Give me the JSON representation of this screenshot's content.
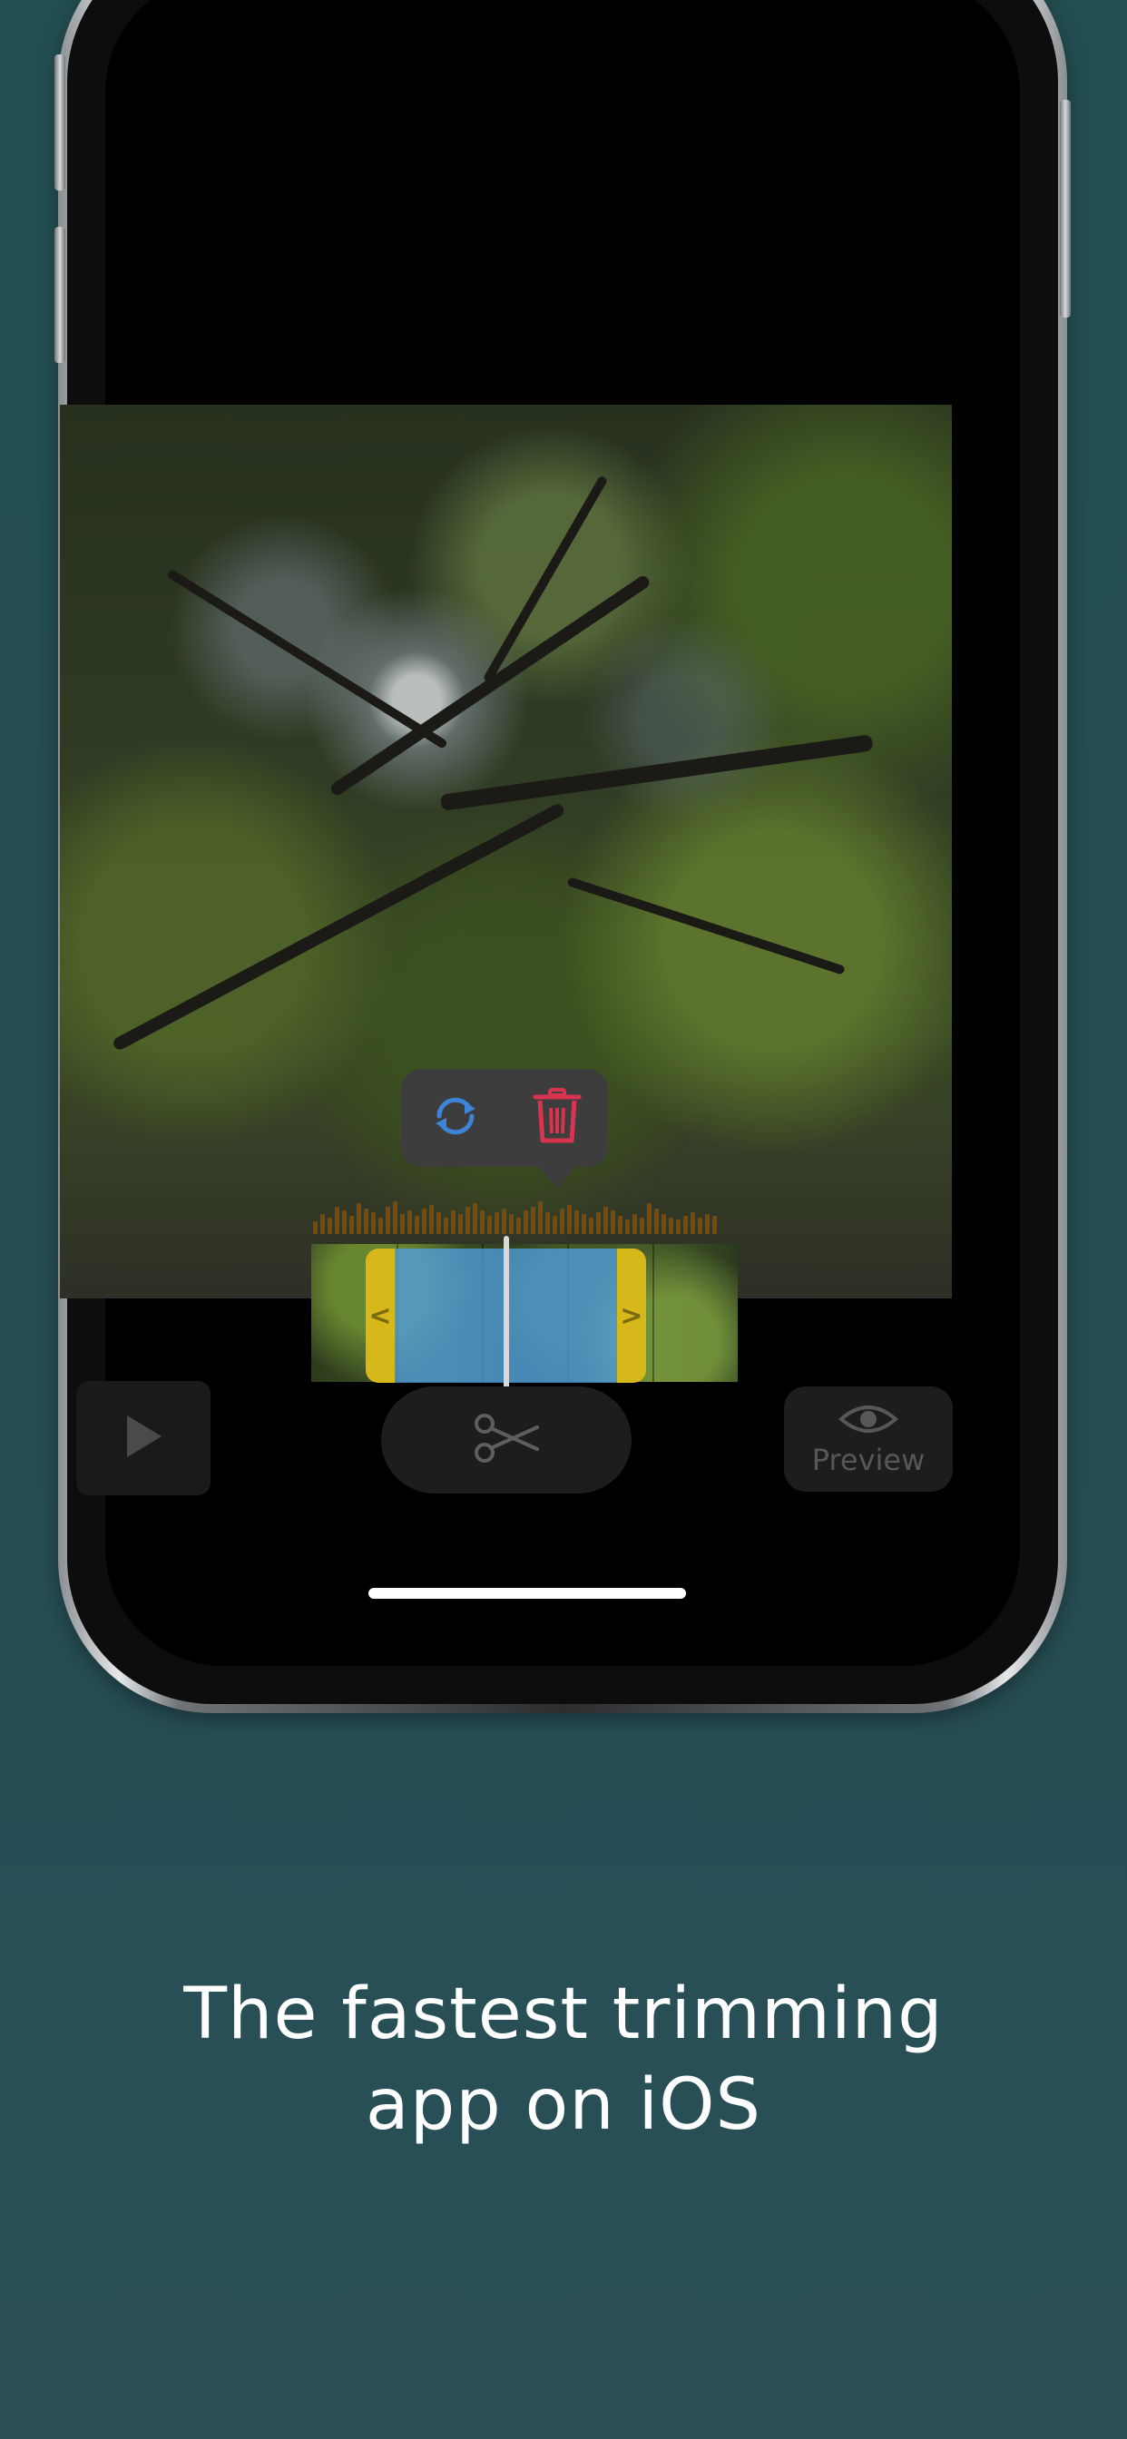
{
  "editor": {
    "popover_actions": [
      {
        "icon": "sync-icon",
        "color": "#3d84d6"
      },
      {
        "icon": "trash-icon",
        "color": "#d8344f"
      }
    ],
    "controls": {
      "play_icon": "play-icon",
      "cut_icon": "scissors-icon",
      "preview_icon": "eye-icon",
      "preview_label": "Preview"
    },
    "accent_colors": {
      "handle": "#d6b81a",
      "selection": "#50a0e6",
      "waveform": "#7a4a0a"
    }
  },
  "marketing": {
    "headline_line1": "The fastest trimming",
    "headline_line2": "app on iOS"
  }
}
